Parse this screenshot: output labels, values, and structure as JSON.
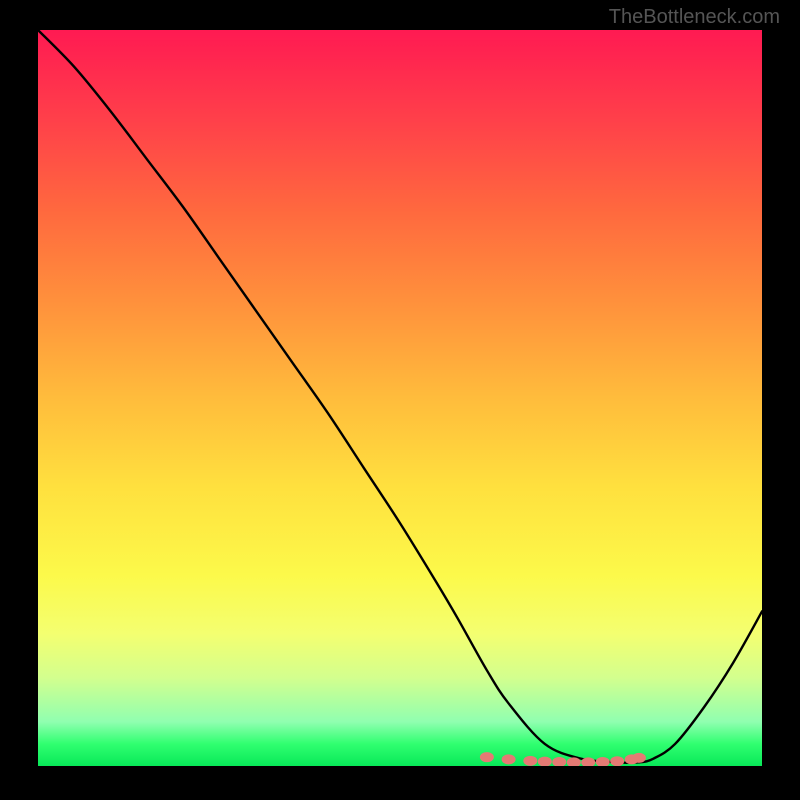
{
  "watermark": "TheBottleneck.com",
  "chart_data": {
    "type": "line",
    "title": "",
    "xlabel": "",
    "ylabel": "",
    "xlim": [
      0,
      100
    ],
    "ylim": [
      0,
      100
    ],
    "series": [
      {
        "name": "curve",
        "x": [
          0,
          5,
          10,
          15,
          20,
          25,
          30,
          35,
          40,
          45,
          50,
          55,
          58,
          62,
          65,
          70,
          75,
          80,
          83,
          85,
          88,
          92,
          96,
          100
        ],
        "values": [
          100,
          95,
          89,
          82.5,
          76,
          69,
          62,
          55,
          48,
          40.5,
          33,
          25,
          20,
          13,
          8.5,
          3,
          1,
          0.5,
          0.5,
          1,
          3,
          8,
          14,
          21
        ]
      },
      {
        "name": "highlight-dots",
        "x": [
          62,
          65,
          68,
          70,
          72,
          74,
          76,
          78,
          80,
          82,
          83
        ],
        "values": [
          1.2,
          0.9,
          0.7,
          0.6,
          0.55,
          0.5,
          0.5,
          0.55,
          0.65,
          0.9,
          1.1
        ]
      }
    ],
    "highlight_color": "#e47a74",
    "curve_color": "#000000"
  }
}
